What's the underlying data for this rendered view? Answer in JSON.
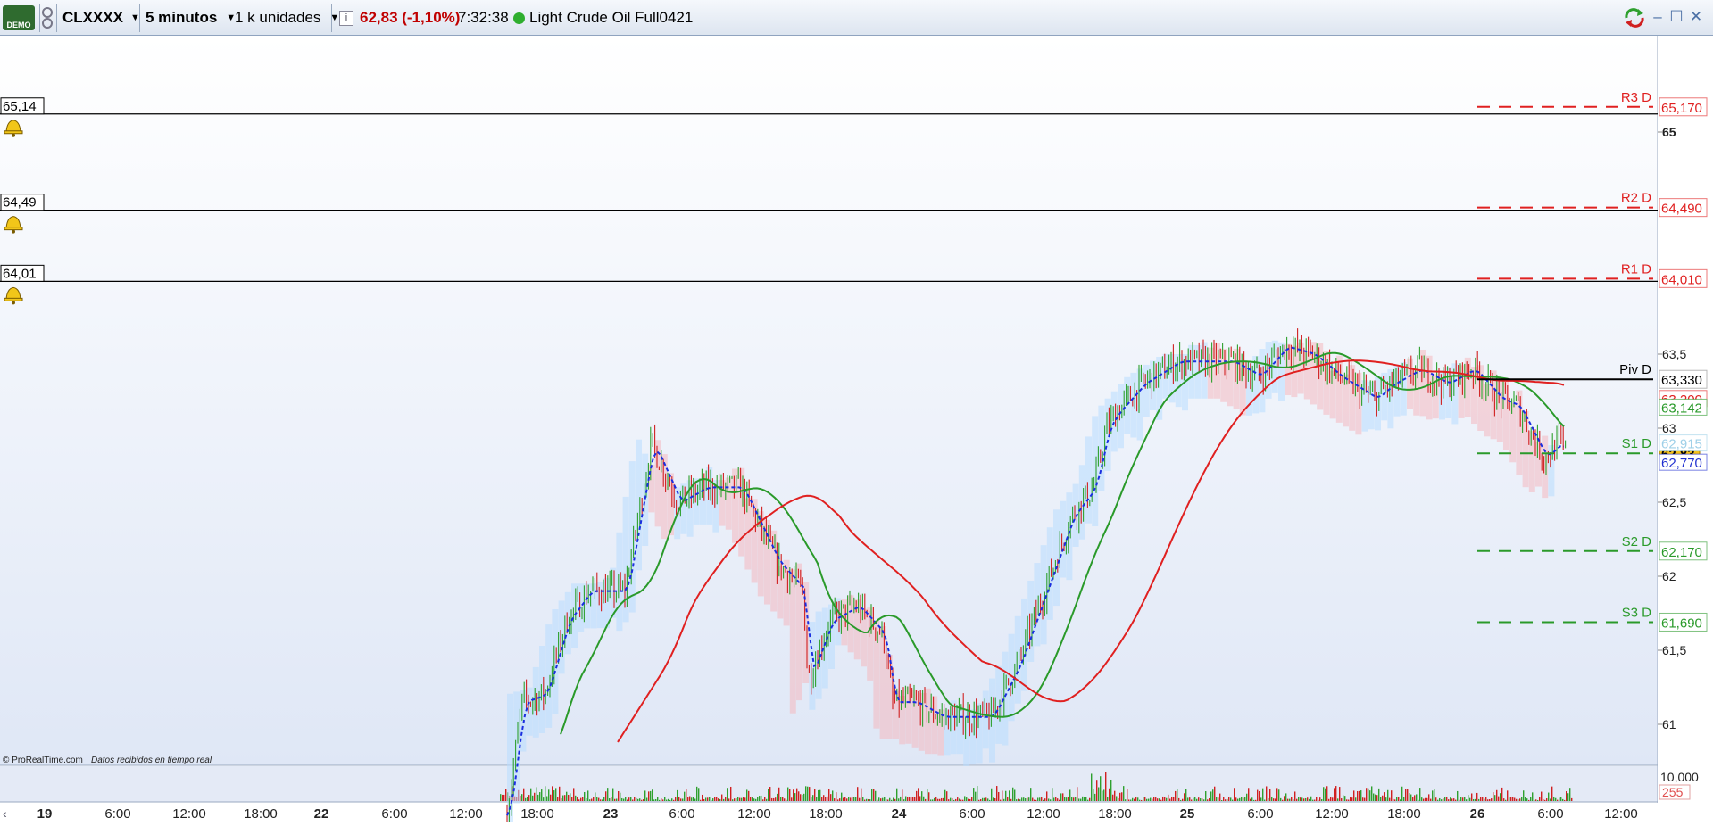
{
  "toolbar": {
    "logo_text": "DEMO",
    "instrument": "CLXXXX",
    "timeframe": "5 minutos",
    "units": "1 k unidades",
    "info_icon": "i",
    "price_change": "62,83 (-1,10%)",
    "time": "7:32:38",
    "status_color": "#2eae2e",
    "instrument_name": "Light Crude Oil Full0421"
  },
  "alerts": [
    {
      "label": "65,14"
    },
    {
      "label": "64,49"
    },
    {
      "label": "64,01"
    }
  ],
  "pivots": [
    {
      "name": "R3 D",
      "value": "65,170",
      "color": "#e02020"
    },
    {
      "name": "R2 D",
      "value": "64,490",
      "color": "#e02020"
    },
    {
      "name": "R1 D",
      "value": "64,010",
      "color": "#e02020"
    },
    {
      "name": "Piv D",
      "value": "63,330",
      "color": "#000000"
    },
    {
      "name": "S1 D",
      "value": "62,83",
      "color": "#2a9a2a"
    },
    {
      "name": "S2 D",
      "value": "62,170",
      "color": "#2a9a2a"
    },
    {
      "name": "S3 D",
      "value": "61,690",
      "color": "#2a9a2a"
    }
  ],
  "price_axis_ticks": [
    "65",
    "63,5",
    "63",
    "62,5",
    "62",
    "61,5",
    "61"
  ],
  "indicator_labels": [
    {
      "value": "63,200",
      "color": "#e02020"
    },
    {
      "value": "63,142",
      "color": "#2a9a2a"
    },
    {
      "value": "62,915",
      "color": "#9fd0e8"
    },
    {
      "value": "62,770",
      "color": "#2030d0"
    }
  ],
  "current_price": "62,83",
  "volume_axis": {
    "top": "10,000",
    "current": "255"
  },
  "time_axis": [
    "19",
    "6:00",
    "12:00",
    "18:00",
    "22",
    "6:00",
    "12:00",
    "18:00",
    "23",
    "6:00",
    "12:00",
    "18:00",
    "24",
    "6:00",
    "12:00",
    "18:00",
    "25",
    "6:00",
    "12:00",
    "18:00",
    "26",
    "6:00",
    "12:00"
  ],
  "copyright": "© ProRealTime.com",
  "realtime_note": "Datos recibidos en tiempo real"
}
